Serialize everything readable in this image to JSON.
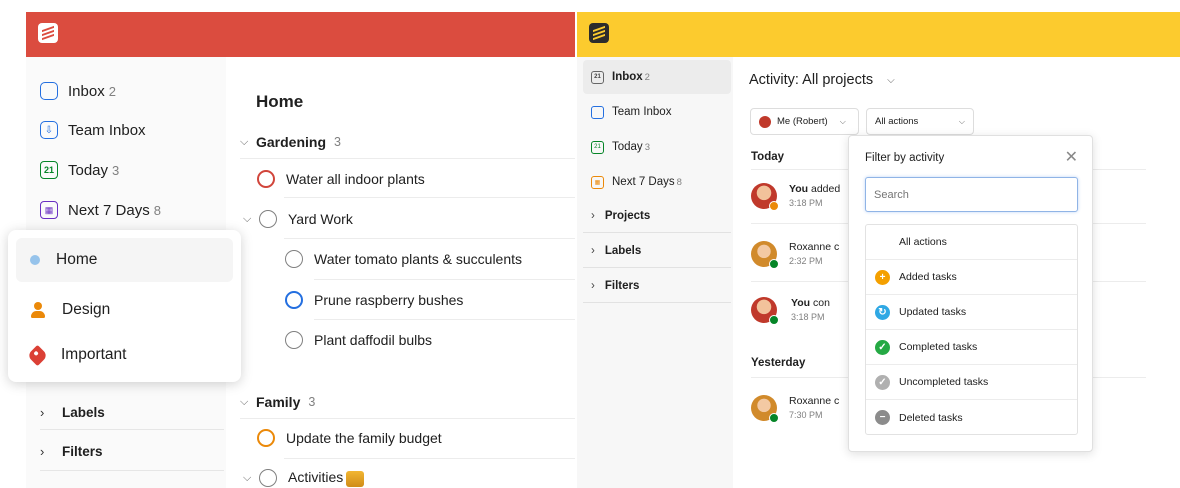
{
  "left_app": {
    "brand_color": "#db4c3f",
    "sidebar": {
      "nav": [
        {
          "label": "Inbox",
          "count": "2",
          "icon": "inbox-icon"
        },
        {
          "label": "Team Inbox",
          "count": "",
          "icon": "team-inbox-icon"
        },
        {
          "label": "Today",
          "count": "3",
          "icon": "calendar-today-icon"
        },
        {
          "label": "Next 7 Days",
          "count": "8",
          "icon": "calendar-week-icon"
        }
      ],
      "projects": [
        {
          "label": "Home",
          "icon": "dot-icon"
        },
        {
          "label": "Design",
          "icon": "person-icon"
        },
        {
          "label": "Important",
          "icon": "tag-icon"
        }
      ],
      "sections": [
        {
          "label": "Labels"
        },
        {
          "label": "Filters"
        }
      ]
    },
    "main": {
      "title": "Home",
      "groups": [
        {
          "name": "Gardening",
          "count": "3"
        },
        {
          "name": "Family",
          "count": "3"
        }
      ],
      "tasks": {
        "water_plants": "Water all indoor plants",
        "yard_work": "Yard Work",
        "water_tomato": "Water tomato plants & succulents",
        "prune": "Prune raspberry bushes",
        "daffodil": "Plant daffodil bulbs",
        "family_budget": "Update the family budget",
        "activities": "Activities"
      }
    }
  },
  "right_app": {
    "brand_color": "#fccb2e",
    "sidebar": {
      "nav": [
        {
          "label": "Inbox",
          "count": "2"
        },
        {
          "label": "Team Inbox",
          "count": ""
        },
        {
          "label": "Today",
          "count": "3"
        },
        {
          "label": "Next 7 Days",
          "count": "8"
        }
      ],
      "sections": [
        {
          "label": "Projects"
        },
        {
          "label": "Labels"
        },
        {
          "label": "Filters"
        }
      ]
    },
    "main": {
      "title": "Activity: All projects",
      "person_filter": "Me (Robert)",
      "action_filter": "All actions",
      "today_label": "Today",
      "yesterday_label": "Yesterday",
      "activity": [
        {
          "who": "You",
          "text": " added",
          "time": "3:18 PM"
        },
        {
          "who": "",
          "text": "Roxanne c",
          "time": "2:32 PM"
        },
        {
          "who": "You",
          "text": " con",
          "time": "3:18 PM"
        },
        {
          "who": "",
          "text": "Roxanne c",
          "time": "7:30 PM"
        }
      ]
    },
    "popup": {
      "title": "Filter by activity",
      "search_placeholder": "Search",
      "options": [
        {
          "label": "All actions",
          "icon": ""
        },
        {
          "label": "Added tasks",
          "icon": "plus-circle-icon"
        },
        {
          "label": "Updated tasks",
          "icon": "refresh-circle-icon"
        },
        {
          "label": "Completed tasks",
          "icon": "check-circle-icon"
        },
        {
          "label": "Uncompleted tasks",
          "icon": "check-circle-gray-icon"
        },
        {
          "label": "Deleted tasks",
          "icon": "minus-circle-icon"
        }
      ]
    }
  }
}
